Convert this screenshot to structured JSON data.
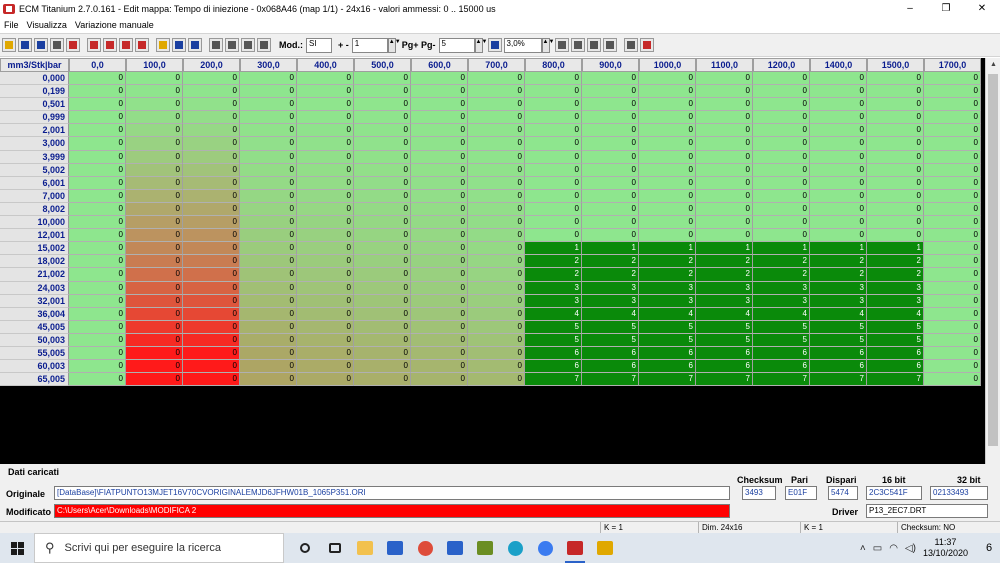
{
  "window": {
    "title": "ECM Titanium 2.7.0.161 - Edit mappa: Tempo di iniezione - 0x068A46 (map 1/1) - 24x16 - valori ammessi: 0 .. 15000 us",
    "minimize": "–",
    "maximize": "❐",
    "close": "✕"
  },
  "menu": [
    "File",
    "Visualizza",
    "Variazione manuale"
  ],
  "toolbar": {
    "mod_label": "Mod.:",
    "mod_value": "SI",
    "plusminus_label": "+ -",
    "plusminus_value": "1",
    "pg_label": "Pg+ Pg-",
    "pg_value": "5",
    "percent_value": "3,0%"
  },
  "grid": {
    "corner": "mm3/Stk|bar",
    "columns": [
      "0,0",
      "100,0",
      "200,0",
      "300,0",
      "400,0",
      "500,0",
      "600,0",
      "700,0",
      "800,0",
      "900,0",
      "1000,0",
      "1100,0",
      "1200,0",
      "1400,0",
      "1500,0",
      "1700,0"
    ],
    "rows": [
      {
        "label": "0,000",
        "values": [
          0,
          0,
          0,
          0,
          0,
          0,
          0,
          0,
          0,
          0,
          0,
          0,
          0,
          0,
          0,
          0
        ]
      },
      {
        "label": "0,199",
        "values": [
          0,
          0,
          0,
          0,
          0,
          0,
          0,
          0,
          0,
          0,
          0,
          0,
          0,
          0,
          0,
          0
        ]
      },
      {
        "label": "0,501",
        "values": [
          0,
          0,
          0,
          0,
          0,
          0,
          0,
          0,
          0,
          0,
          0,
          0,
          0,
          0,
          0,
          0
        ]
      },
      {
        "label": "0,999",
        "values": [
          0,
          0,
          0,
          0,
          0,
          0,
          0,
          0,
          0,
          0,
          0,
          0,
          0,
          0,
          0,
          0
        ]
      },
      {
        "label": "2,001",
        "values": [
          0,
          0,
          0,
          0,
          0,
          0,
          0,
          0,
          0,
          0,
          0,
          0,
          0,
          0,
          0,
          0
        ]
      },
      {
        "label": "3,000",
        "values": [
          0,
          0,
          0,
          0,
          0,
          0,
          0,
          0,
          0,
          0,
          0,
          0,
          0,
          0,
          0,
          0
        ]
      },
      {
        "label": "3,999",
        "values": [
          0,
          0,
          0,
          0,
          0,
          0,
          0,
          0,
          0,
          0,
          0,
          0,
          0,
          0,
          0,
          0
        ]
      },
      {
        "label": "5,002",
        "values": [
          0,
          0,
          0,
          0,
          0,
          0,
          0,
          0,
          0,
          0,
          0,
          0,
          0,
          0,
          0,
          0
        ]
      },
      {
        "label": "6,001",
        "values": [
          0,
          0,
          0,
          0,
          0,
          0,
          0,
          0,
          0,
          0,
          0,
          0,
          0,
          0,
          0,
          0
        ]
      },
      {
        "label": "7,000",
        "values": [
          0,
          0,
          0,
          0,
          0,
          0,
          0,
          0,
          0,
          0,
          0,
          0,
          0,
          0,
          0,
          0
        ]
      },
      {
        "label": "8,002",
        "values": [
          0,
          0,
          0,
          0,
          0,
          0,
          0,
          0,
          0,
          0,
          0,
          0,
          0,
          0,
          0,
          0
        ]
      },
      {
        "label": "10,000",
        "values": [
          0,
          0,
          0,
          0,
          0,
          0,
          0,
          0,
          0,
          0,
          0,
          0,
          0,
          0,
          0,
          0
        ]
      },
      {
        "label": "12,001",
        "values": [
          0,
          0,
          0,
          0,
          0,
          0,
          0,
          0,
          0,
          0,
          0,
          0,
          0,
          0,
          0,
          0
        ]
      },
      {
        "label": "15,002",
        "values": [
          0,
          0,
          0,
          0,
          0,
          0,
          0,
          0,
          1,
          1,
          1,
          1,
          1,
          1,
          1,
          0
        ]
      },
      {
        "label": "18,002",
        "values": [
          0,
          0,
          0,
          0,
          0,
          0,
          0,
          0,
          2,
          2,
          2,
          2,
          2,
          2,
          2,
          0
        ]
      },
      {
        "label": "21,002",
        "values": [
          0,
          0,
          0,
          0,
          0,
          0,
          0,
          0,
          2,
          2,
          2,
          2,
          2,
          2,
          2,
          0
        ]
      },
      {
        "label": "24,003",
        "values": [
          0,
          0,
          0,
          0,
          0,
          0,
          0,
          0,
          3,
          3,
          3,
          3,
          3,
          3,
          3,
          0
        ]
      },
      {
        "label": "32,001",
        "values": [
          0,
          0,
          0,
          0,
          0,
          0,
          0,
          0,
          3,
          3,
          3,
          3,
          3,
          3,
          3,
          0
        ]
      },
      {
        "label": "36,004",
        "values": [
          0,
          0,
          0,
          0,
          0,
          0,
          0,
          0,
          4,
          4,
          4,
          4,
          4,
          4,
          4,
          0
        ]
      },
      {
        "label": "45,005",
        "values": [
          0,
          0,
          0,
          0,
          0,
          0,
          0,
          0,
          5,
          5,
          5,
          5,
          5,
          5,
          5,
          0
        ]
      },
      {
        "label": "50,003",
        "values": [
          0,
          0,
          0,
          0,
          0,
          0,
          0,
          0,
          5,
          5,
          5,
          5,
          5,
          5,
          5,
          0
        ]
      },
      {
        "label": "55,005",
        "values": [
          0,
          0,
          0,
          0,
          0,
          0,
          0,
          0,
          6,
          6,
          6,
          6,
          6,
          6,
          6,
          0
        ]
      },
      {
        "label": "60,003",
        "values": [
          0,
          0,
          0,
          0,
          0,
          0,
          0,
          0,
          6,
          6,
          6,
          6,
          6,
          6,
          6,
          0
        ]
      },
      {
        "label": "65,005",
        "values": [
          0,
          0,
          0,
          0,
          0,
          0,
          0,
          0,
          7,
          7,
          7,
          7,
          7,
          7,
          7,
          0
        ]
      }
    ],
    "colors": {
      "light_green": "#8ee68e",
      "dark_green": "#0a8a0a",
      "red": "#ff1a1a",
      "olive": "#b0a060"
    }
  },
  "info": {
    "title": "Dati caricati",
    "originale_label": "Originale",
    "originale_value": "[DataBase]\\FIATPUNTO13MJET16V70CVORIGINALEMJD6JFHW01B_1065P351.ORI",
    "modificato_label": "Modificato",
    "modificato_value": "C:\\Users\\Acer\\Downloads\\MODIFICA 2",
    "checksum_label": "Checksum",
    "checksum_value": "3493",
    "pari_label": "Pari",
    "pari_value": "E01F",
    "dispari_label": "Dispari",
    "dispari_value": "5474",
    "bit16_label": "16 bit",
    "bit16_value": "2C3C541F",
    "bit32_label": "32 bit",
    "bit32_value": "02133493",
    "driver_label": "Driver",
    "driver_value": "P13_2EC7.DRT"
  },
  "status": {
    "k1": "K = 1",
    "dim": "Dim. 24x16",
    "k2": "K = 1",
    "checksum": "Checksum: NO"
  },
  "taskbar": {
    "search_placeholder": "Scrivi qui per eseguire la ricerca",
    "time": "11:37",
    "date": "13/10/2020",
    "notifications": "6"
  }
}
